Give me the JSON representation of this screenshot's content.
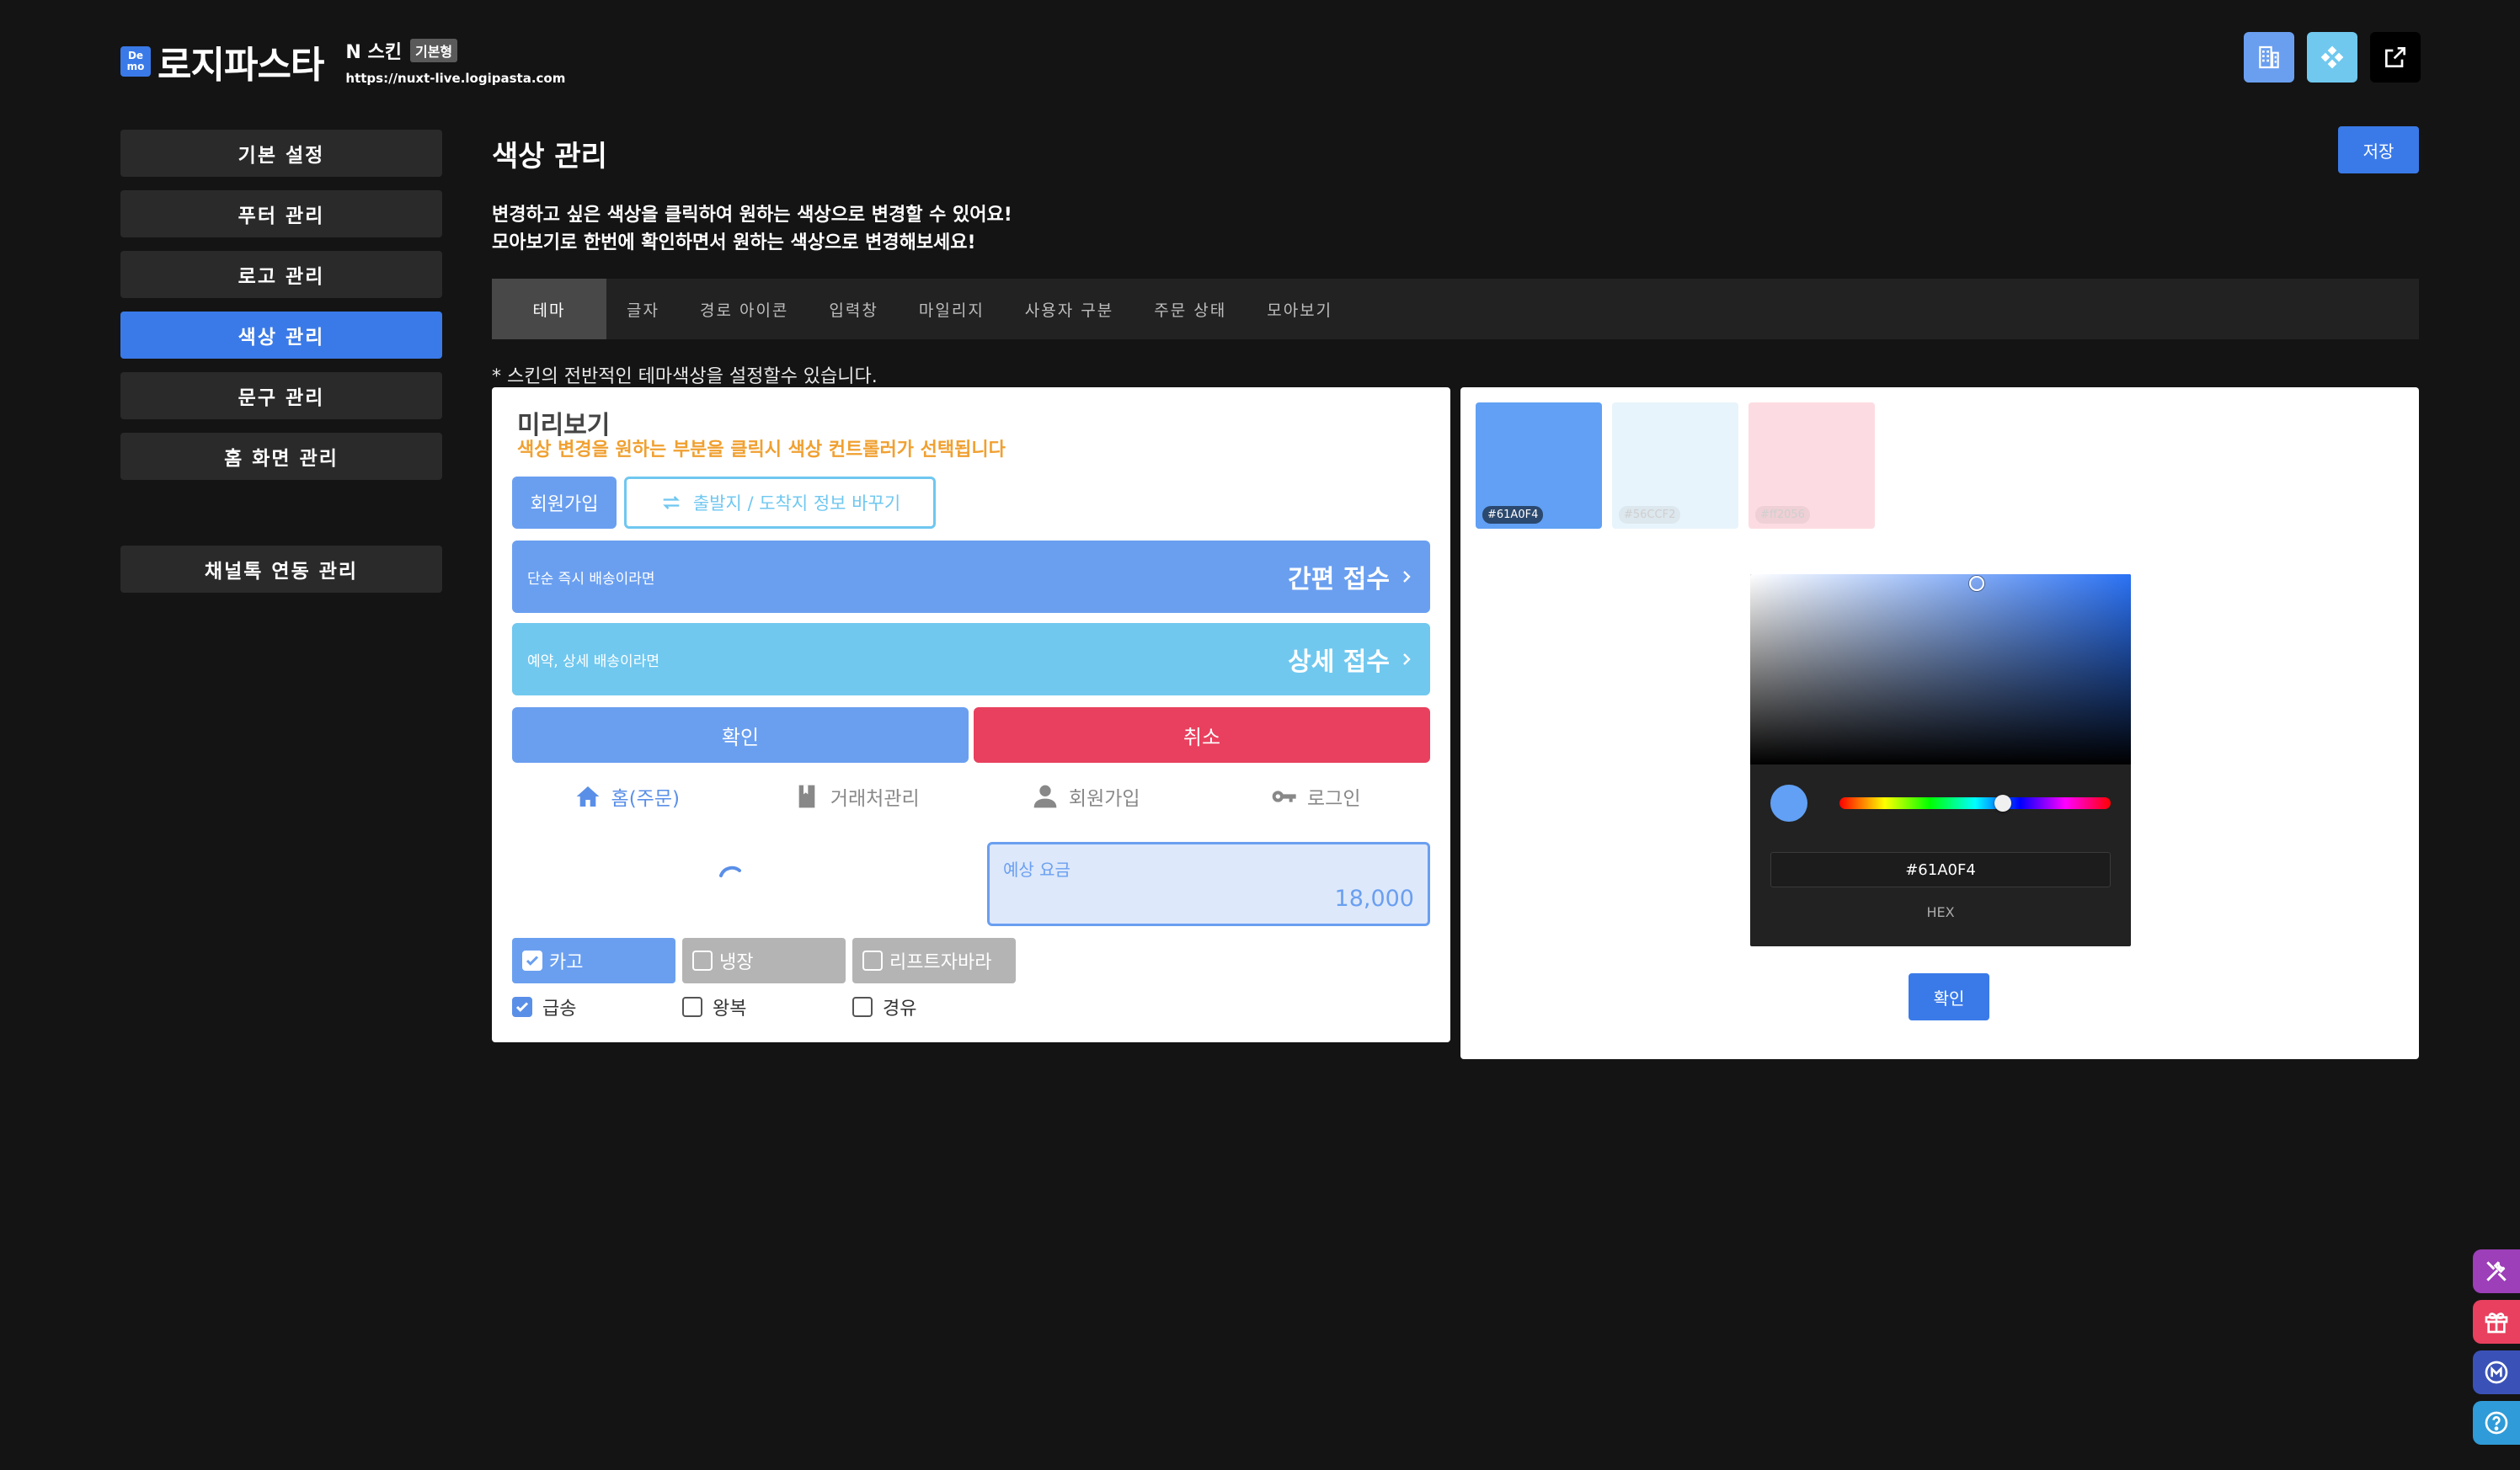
{
  "header": {
    "demo_top": "De",
    "demo_bottom": "mo",
    "brand": "로지파스타",
    "skin_name": "N 스킨",
    "skin_type": "기본형",
    "url": "https://nuxt-live.logipasta.com"
  },
  "top_icons": [
    {
      "name": "building-icon",
      "color": "#6a9ff0"
    },
    {
      "name": "diamond-icon",
      "color": "#70c8ef"
    },
    {
      "name": "external-link-icon",
      "color": "#000000"
    }
  ],
  "sidebar": {
    "items": [
      {
        "label": "기본 설정",
        "active": false
      },
      {
        "label": "푸터 관리",
        "active": false
      },
      {
        "label": "로고 관리",
        "active": false
      },
      {
        "label": "색상 관리",
        "active": true
      },
      {
        "label": "문구 관리",
        "active": false
      },
      {
        "label": "홈 화면 관리",
        "active": false
      },
      {
        "label": "채널톡 연동 관리",
        "active": false
      }
    ]
  },
  "main": {
    "title": "색상 관리",
    "save_label": "저장",
    "desc_line1": "변경하고 싶은 색상을 클릭하여 원하는 색상으로 변경할 수 있어요!",
    "desc_line2": "모아보기로 한번에 확인하면서 원하는 색상으로 변경해보세요!",
    "tabs": [
      "테마",
      "글자",
      "경로 아이콘",
      "입력창",
      "마일리지",
      "사용자 구분",
      "주문 상태",
      "모아보기"
    ],
    "active_tab": 0,
    "hint": "* 스킨의 전반적인 테마색상을 설정할수 있습니다."
  },
  "preview": {
    "title": "미리보기",
    "subtitle": "색상 변경을 원하는 부분을 클릭시 색상 컨트롤러가 선택됩니다",
    "signup_btn": "회원가입",
    "swap_btn": "출발지 / 도착지 정보 바꾸기",
    "bar1_small": "단순 즉시 배송이라면",
    "bar1_big": "간편 접수",
    "bar2_small": "예약, 상세 배송이라면",
    "bar2_big": "상세 접수",
    "ok_btn": "확인",
    "cancel_btn": "취소",
    "nav": [
      {
        "label": "홈(주문)",
        "icon": "home-icon",
        "active": true
      },
      {
        "label": "거래처관리",
        "icon": "book-icon",
        "active": false
      },
      {
        "label": "회원가입",
        "icon": "person-icon",
        "active": false
      },
      {
        "label": "로그인",
        "icon": "key-icon",
        "active": false
      }
    ],
    "fee_label": "예상 요금",
    "fee_value": "18,000",
    "chips": [
      {
        "label": "카고",
        "checked": true
      },
      {
        "label": "냉장",
        "checked": false
      },
      {
        "label": "리프트자바라",
        "checked": false
      }
    ],
    "checks": [
      {
        "label": "급송",
        "checked": true
      },
      {
        "label": "왕복",
        "checked": false
      },
      {
        "label": "경유",
        "checked": false
      }
    ]
  },
  "colors": {
    "swatches": [
      {
        "hex": "#61A0F4",
        "label": "#61A0F4"
      },
      {
        "hex": "#E8F4FB",
        "label": "#56CCF2"
      },
      {
        "hex": "#FCDCE2",
        "label": "#ff2056"
      }
    ],
    "picker": {
      "hex_value": "#61A0F4",
      "hex_label": "HEX",
      "confirm": "확인",
      "hue_position": 0.6,
      "current": "#61A0F4"
    }
  },
  "floating": [
    {
      "name": "tools-icon",
      "color": "#9c3fb8"
    },
    {
      "name": "gift-icon",
      "color": "#e8405e"
    },
    {
      "name": "m-circle-icon",
      "color": "#3a52b8"
    },
    {
      "name": "help-icon",
      "color": "#2f9bd8"
    }
  ]
}
